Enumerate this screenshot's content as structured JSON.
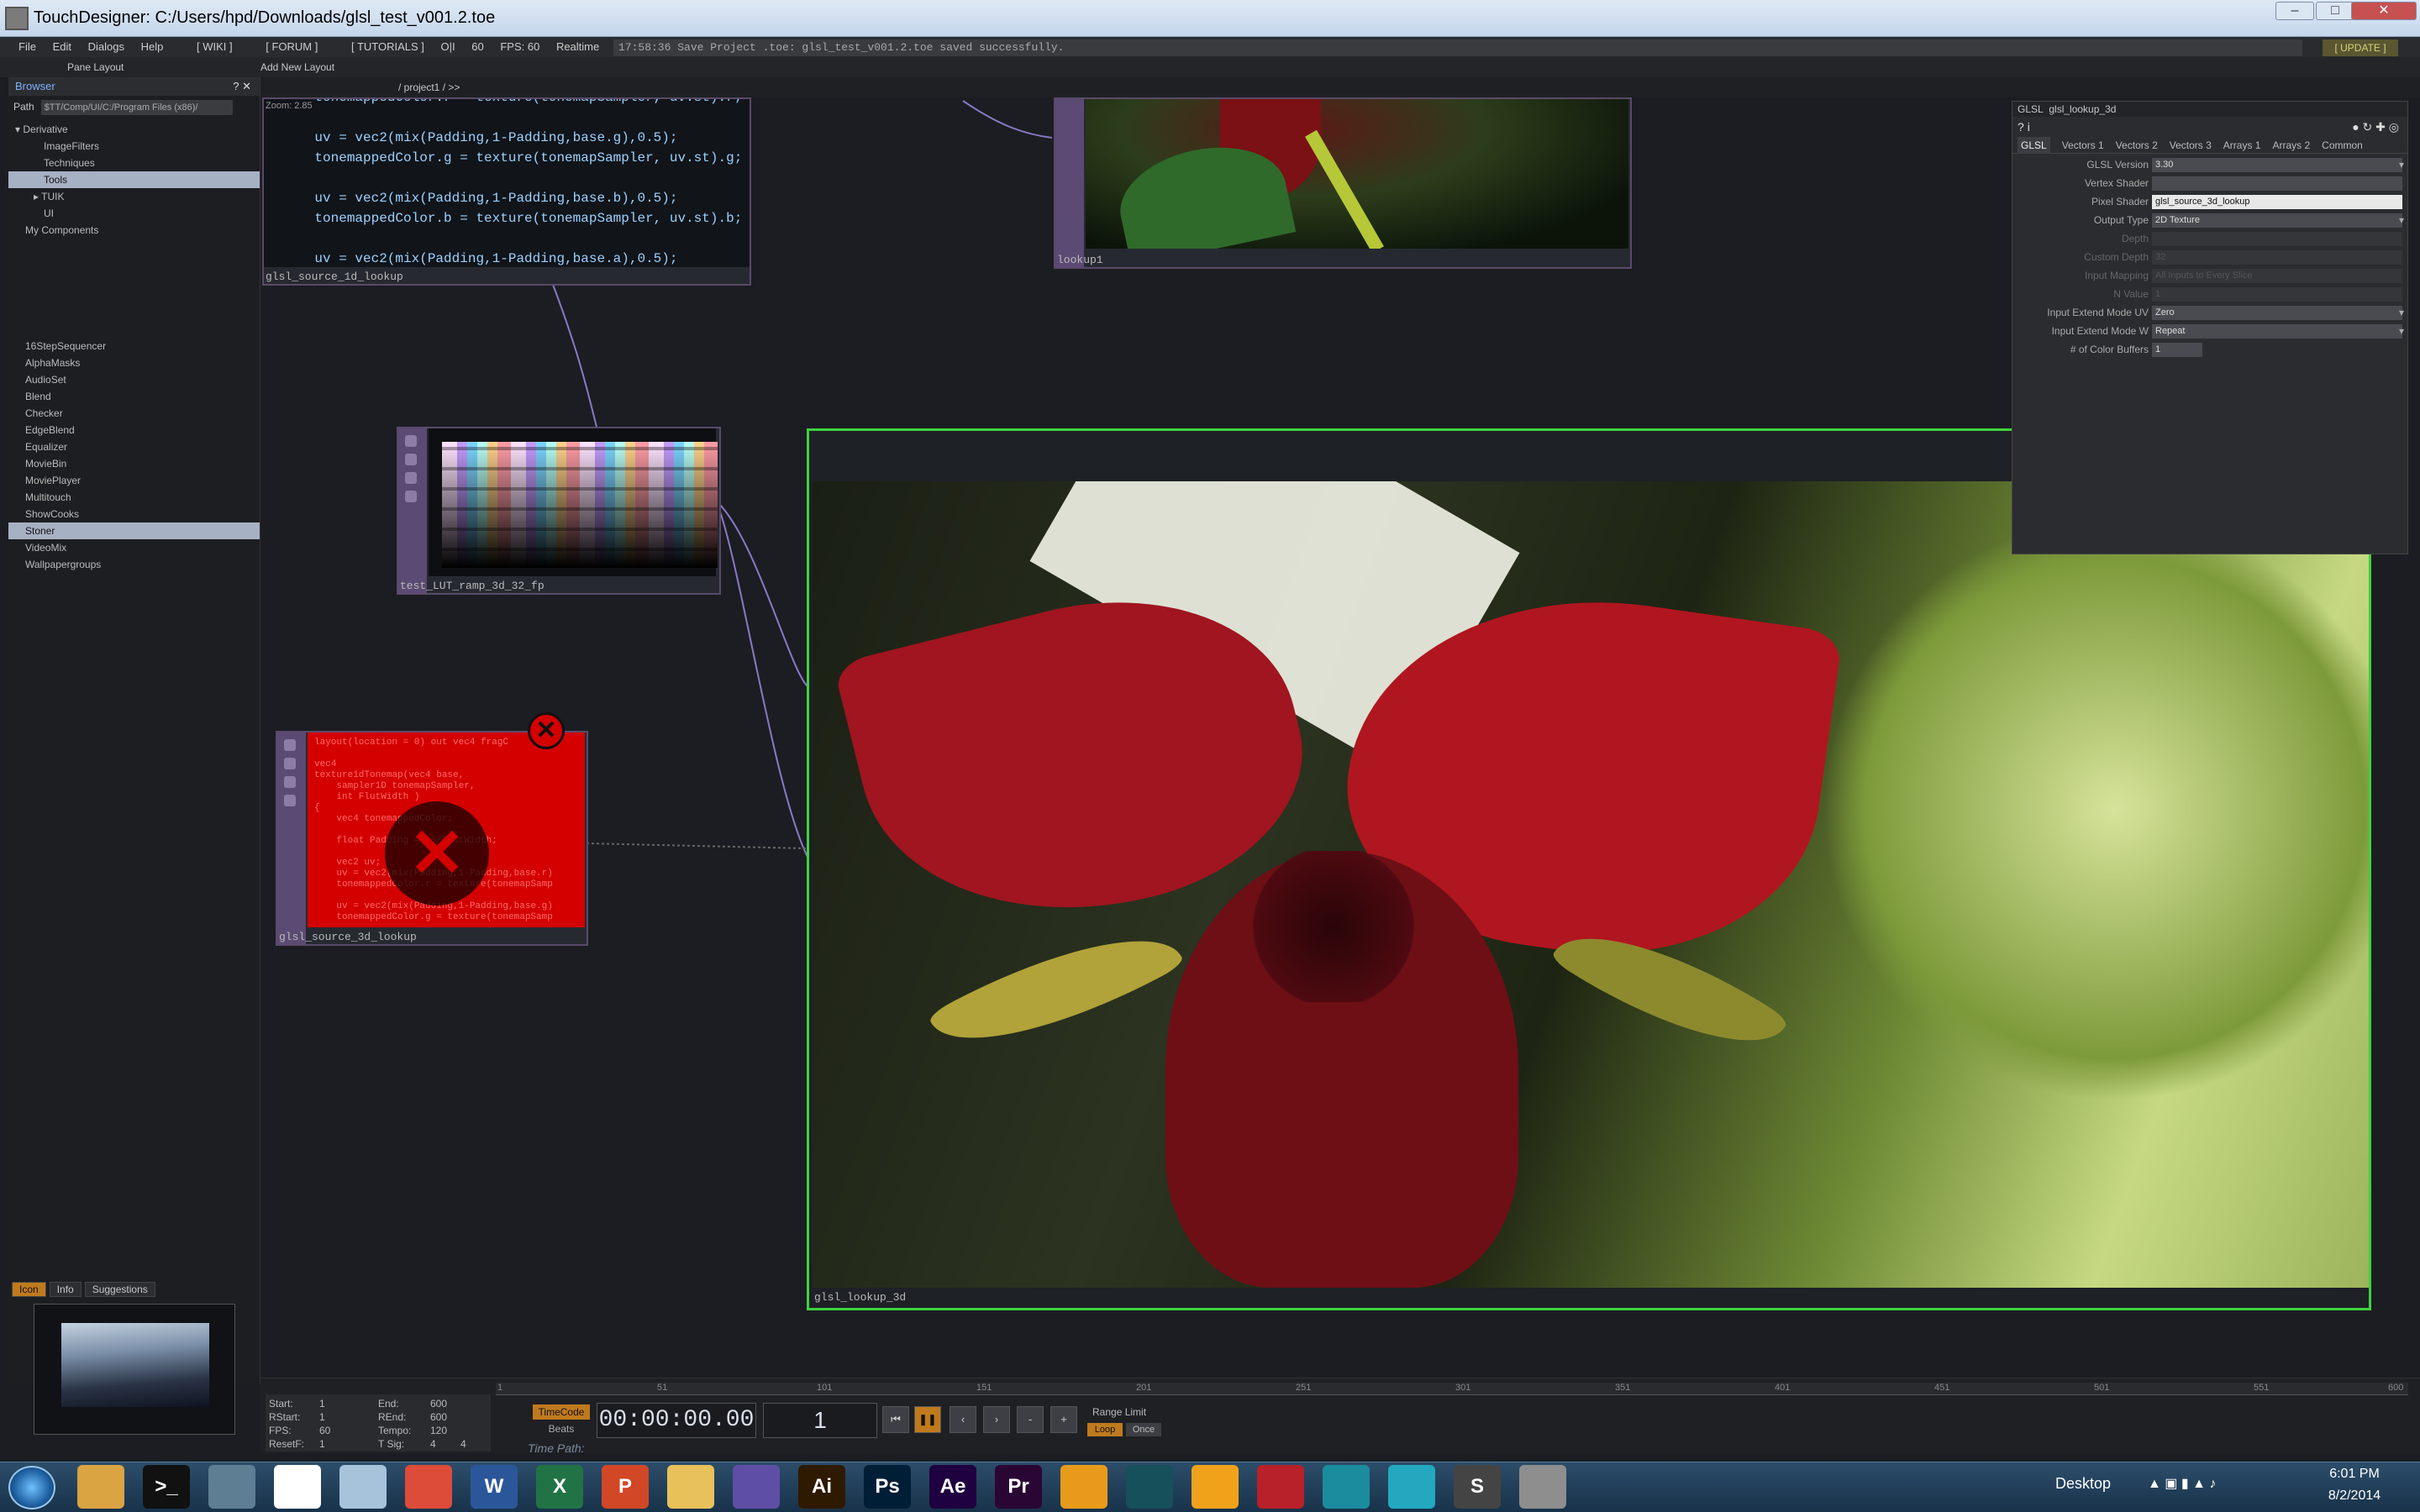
{
  "window": {
    "title": "TouchDesigner: C:/Users/hpd/Downloads/glsl_test_v001.2.toe"
  },
  "menu": [
    "File",
    "Edit",
    "Dialogs",
    "Help",
    "[ WIKI ]",
    "[ FORUM ]",
    "[ TUTORIALS ]",
    "O|I",
    "60",
    "FPS: 60",
    "Realtime"
  ],
  "status_message": "17:58:36 Save Project .toe: glsl_test_v001.2.toe saved successfully.",
  "update_label": "[ UPDATE ]",
  "layout_bar": {
    "pane_layout": "Pane Layout",
    "add_layout": "Add New Layout"
  },
  "nav": {
    "path": "/ project1 / >>",
    "zoom": "Zoom: 2.85"
  },
  "browser": {
    "title": "Browser",
    "path_label": "Path",
    "path_value": "$TT/Comp/UI/C:/Program Files (x86)/",
    "tree": [
      "Derivative",
      "ImageFilters",
      "Techniques",
      "Tools",
      "TUIK",
      "UI",
      "My Components"
    ],
    "components": [
      "16StepSequencer",
      "AlphaMasks",
      "AudioSet",
      "Blend",
      "Checker",
      "EdgeBlend",
      "Equalizer",
      "MovieBin",
      "MoviePlayer",
      "Multitouch",
      "ShowCooks",
      "Stoner",
      "VideoMix",
      "Wallpapergroups"
    ],
    "tabs": [
      "Icon",
      "Info",
      "Suggestions"
    ]
  },
  "nodes": {
    "source1d": {
      "label": "glsl_source_1d_lookup",
      "code": "    tonemappedColor.r = texture(tonemapSampler, uv.st).r;\n\n    uv = vec2(mix(Padding,1-Padding,base.g),0.5);\n    tonemappedColor.g = texture(tonemapSampler, uv.st).g;\n\n    uv = vec2(mix(Padding,1-Padding,base.b),0.5);\n    tonemappedColor.b = texture(tonemapSampler, uv.st).b;\n\n    uv = vec2(mix(Padding,1-Padding,base.a),0.5);\n    tonemappedColor.a = texture(tonemapSampler, uv.st).a;\n\n    return tonemappedColor;"
    },
    "lookup1": {
      "label": "lookup1"
    },
    "ramp": {
      "label": "test_LUT_ramp_3d_32_fp"
    },
    "source3d": {
      "label": "glsl_source_3d_lookup",
      "code": "layout(location = 0) out vec4 fragC\n\nvec4\ntexture1dTonemap(vec4 base,\n    sampler1D tonemapSampler,\n    int FlutWidth )\n{\n    vec4 tonemappedColor;\n\n    float Padding = .5/FlutWidth;\n\n    vec2 uv;\n    uv = vec2(mix(Padding,1-Padding,base.r)\n    tonemappedColor.r = texture(tonemapSamp\n\n    uv = vec2(mix(Padding,1-Padding,base.g)\n    tonemappedColor.g = texture(tonemapSamp"
    },
    "main": {
      "label": "glsl_lookup_3d"
    }
  },
  "params": {
    "type": "GLSL",
    "name": "glsl_lookup_3d",
    "tabs": [
      "GLSL",
      "Vectors 1",
      "Vectors 2",
      "Vectors 3",
      "Arrays 1",
      "Arrays 2",
      "Common"
    ],
    "rows": [
      {
        "label": "GLSL Version",
        "value": "3.30",
        "enabled": true
      },
      {
        "label": "Vertex Shader",
        "value": "",
        "enabled": true
      },
      {
        "label": "Pixel Shader",
        "value": "glsl_source_3d_lookup",
        "enabled": true
      },
      {
        "label": "Output Type",
        "value": "2D Texture",
        "enabled": true
      },
      {
        "label": "Depth",
        "value": "",
        "enabled": false
      },
      {
        "label": "Custom Depth",
        "value": "32",
        "enabled": false
      },
      {
        "label": "Input Mapping",
        "value": "All Inputs to Every Slice",
        "enabled": false
      },
      {
        "label": "N Value",
        "value": "1",
        "enabled": false
      },
      {
        "label": "Input Extend Mode UV",
        "value": "Zero",
        "enabled": true
      },
      {
        "label": "Input Extend Mode W",
        "value": "Repeat",
        "enabled": true
      },
      {
        "label": "# of Color Buffers",
        "value": "1",
        "enabled": true
      }
    ]
  },
  "timeline": {
    "ruler": [
      "1",
      "51",
      "101",
      "151",
      "201",
      "251",
      "301",
      "351",
      "401",
      "451",
      "501",
      "551",
      "600"
    ],
    "start_label": "Start:",
    "start": "1",
    "end_label": "End:",
    "end": "600",
    "rstart_label": "RStart:",
    "rstart": "1",
    "rend_label": "REnd:",
    "rend": "600",
    "fps_label": "FPS:",
    "fps": "60",
    "tempo_label": "Tempo:",
    "tempo": "120",
    "resetf_label": "ResetF:",
    "resetf": "1",
    "tsig_label": "T Sig:",
    "tsig_a": "4",
    "tsig_b": "4",
    "timecode_label": "TimeCode",
    "beats_label": "Beats",
    "timecode": "00:00:00.00",
    "frame": "1",
    "range_limit": "Range Limit",
    "loop": "Loop",
    "once": "Once",
    "time_path": "Time Path:"
  },
  "taskbar": {
    "apps": [
      {
        "name": "explorer",
        "label": "",
        "color": "#d9a441"
      },
      {
        "name": "cmd",
        "label": ">_",
        "color": "#111111"
      },
      {
        "name": "monitor",
        "label": "",
        "color": "#5d7e93"
      },
      {
        "name": "notepad",
        "label": "",
        "color": "#ffffff"
      },
      {
        "name": "paper",
        "label": "",
        "color": "#a7c3dc"
      },
      {
        "name": "chrome",
        "label": "",
        "color": "#dd4b39"
      },
      {
        "name": "word",
        "label": "W",
        "color": "#2b579a"
      },
      {
        "name": "excel",
        "label": "X",
        "color": "#217346"
      },
      {
        "name": "powerpoint",
        "label": "P",
        "color": "#d24726"
      },
      {
        "name": "folder",
        "label": "",
        "color": "#e8c15a"
      },
      {
        "name": "vs",
        "label": "",
        "color": "#5f4ea5"
      },
      {
        "name": "illustrator",
        "label": "Ai",
        "color": "#2e1a00"
      },
      {
        "name": "photoshop",
        "label": "Ps",
        "color": "#001e36"
      },
      {
        "name": "aftereffects",
        "label": "Ae",
        "color": "#1f0040"
      },
      {
        "name": "premiere",
        "label": "Pr",
        "color": "#2a0634"
      },
      {
        "name": "nuke",
        "label": "",
        "color": "#e89b1a"
      },
      {
        "name": "app17",
        "label": "",
        "color": "#16505a"
      },
      {
        "name": "app18",
        "label": "",
        "color": "#f0a21b"
      },
      {
        "name": "app19",
        "label": "",
        "color": "#b8202a"
      },
      {
        "name": "maya1",
        "label": "",
        "color": "#1b8c9e"
      },
      {
        "name": "maya2",
        "label": "",
        "color": "#23a8c0"
      },
      {
        "name": "sublime",
        "label": "S",
        "color": "#444444"
      },
      {
        "name": "touchdesigner",
        "label": "",
        "color": "#8e8e8e"
      }
    ],
    "desktop": "Desktop",
    "time": "6:01 PM",
    "date": "8/2/2014"
  }
}
